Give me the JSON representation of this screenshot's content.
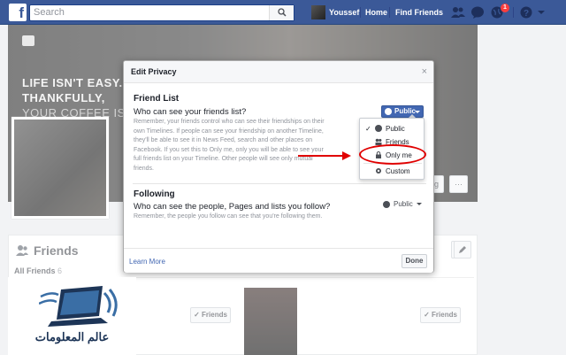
{
  "topbar": {
    "logo": "f",
    "search_placeholder": "Search",
    "user_name": "Youssef",
    "nav_home": "Home",
    "nav_find_friends": "Find Friends",
    "notif_count": "1",
    "icons": [
      "friend-requests-icon",
      "messages-icon",
      "globe-icon",
      "help-icon"
    ]
  },
  "cover": {
    "line1": "LIFE ISN'T EASY.",
    "line2": "THANKFULLY,",
    "line3": "YOUR COFFEE IS.",
    "buttons": [
      "og",
      "···"
    ]
  },
  "friends_section": {
    "title": "Friends",
    "all_friends_label": "All Friends",
    "all_friends_count": "6",
    "friend_button": "Friends"
  },
  "dialog": {
    "title": "Edit Privacy",
    "close": "×",
    "friend_list": {
      "title": "Friend List",
      "question": "Who can see your friends list?",
      "description": "Remember, your friends control who can see their friendships on their own Timelines. If people can see your friendship on another Timeline, they'll be able to see it in News Feed, search and other places on Facebook. If you set this to Only me, only you will be able to see your full friends list on your Timeline. Other people will see only mutual friends.",
      "selected": "Public"
    },
    "following": {
      "title": "Following",
      "question": "Who can see the people, Pages and lists you follow?",
      "description": "Remember, the people you follow can see that you're following them.",
      "selected": "Public"
    },
    "learn_more": "Learn More",
    "done": "Done"
  },
  "privacy_menu": {
    "items": [
      {
        "label": "Public",
        "icon": "globe-icon",
        "checked": "✓"
      },
      {
        "label": "Friends",
        "icon": "friends-icon"
      },
      {
        "label": "Only me",
        "icon": "lock-icon"
      },
      {
        "label": "Custom",
        "icon": "gear-icon"
      }
    ]
  },
  "watermark": {
    "text": "عالم المعلومات"
  },
  "colors": {
    "brand": "#3b5998",
    "highlight": "#e00000",
    "link": "#4267b2"
  }
}
